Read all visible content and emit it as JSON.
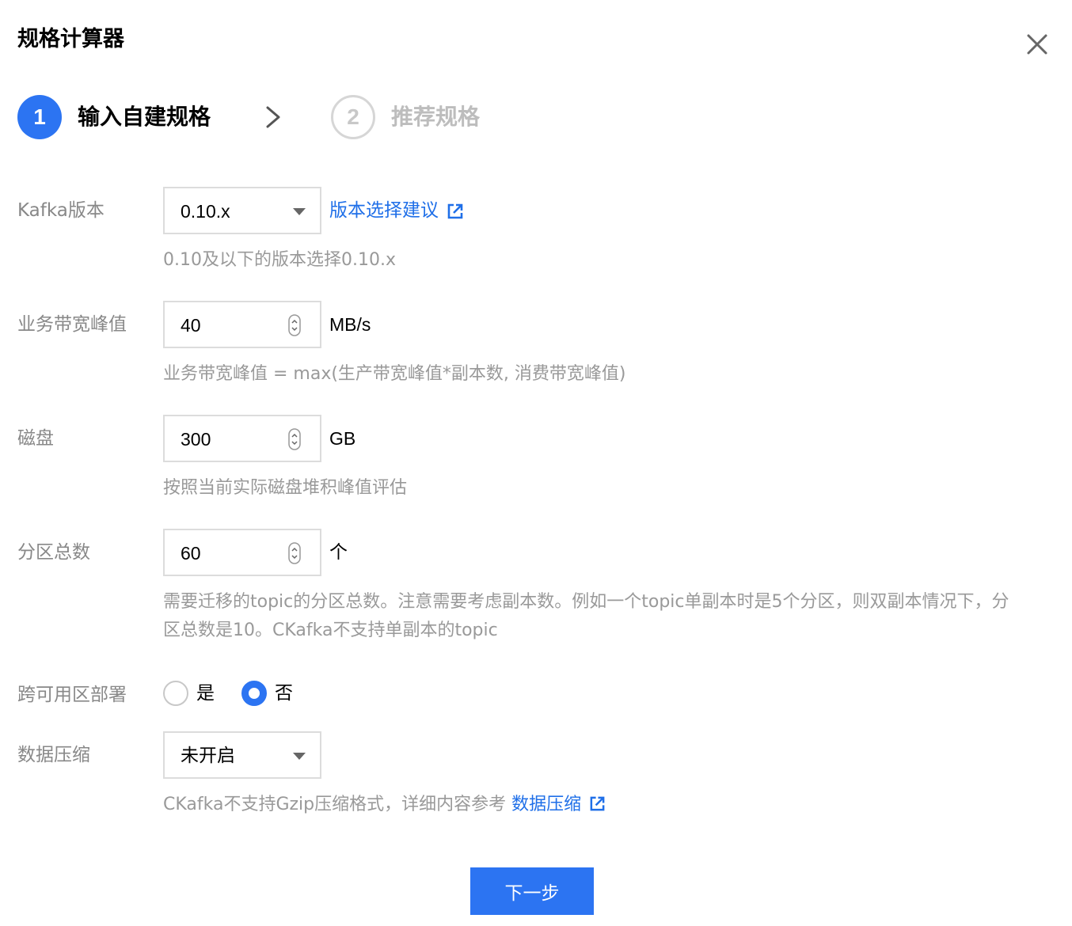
{
  "dialog": {
    "title": "规格计算器",
    "close_icon": "close-icon"
  },
  "steps": [
    {
      "number": "1",
      "label": "输入自建规格",
      "state": "active"
    },
    {
      "number": "2",
      "label": "推荐规格",
      "state": "inactive"
    }
  ],
  "form": {
    "kafka_version": {
      "label": "Kafka版本",
      "value": "0.10.x",
      "link_text": "版本选择建议",
      "link_icon": "external-link-icon",
      "help": "0.10及以下的版本选择0.10.x"
    },
    "bandwidth": {
      "label": "业务带宽峰值",
      "value": "40",
      "unit": "MB/s",
      "help": "业务带宽峰值 = max(生产带宽峰值*副本数, 消费带宽峰值)"
    },
    "disk": {
      "label": "磁盘",
      "value": "300",
      "unit": "GB",
      "help": "按照当前实际磁盘堆积峰值评估"
    },
    "partitions": {
      "label": "分区总数",
      "value": "60",
      "unit": "个",
      "help": "需要迁移的topic的分区总数。注意需要考虑副本数。例如一个topic单副本时是5个分区，则双副本情况下，分区总数是10。CKafka不支持单副本的topic"
    },
    "cross_az": {
      "label": "跨可用区部署",
      "options": [
        {
          "label": "是",
          "checked": false
        },
        {
          "label": "否",
          "checked": true
        }
      ]
    },
    "compression": {
      "label": "数据压缩",
      "value": "未开启",
      "help_prefix": "CKafka不支持Gzip压缩格式，详细内容参考 ",
      "help_link": "数据压缩",
      "link_icon": "external-link-icon"
    }
  },
  "actions": {
    "next_label": "下一步"
  },
  "colors": {
    "primary": "#2c74f2",
    "link": "#1f6fe8",
    "label": "#888888",
    "help": "#999999"
  }
}
